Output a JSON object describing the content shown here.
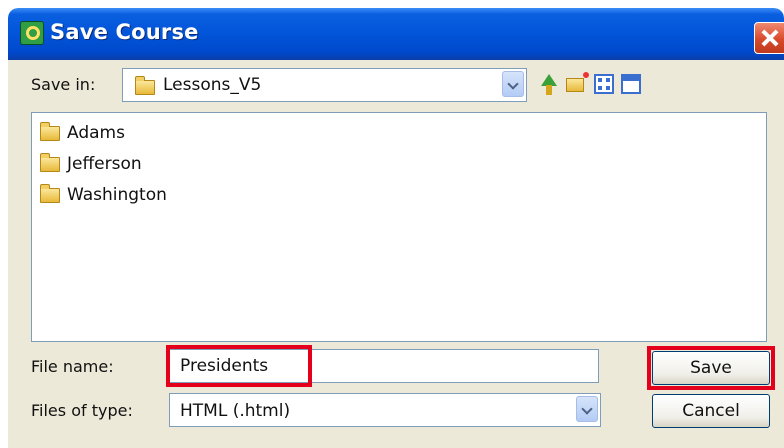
{
  "dialog": {
    "title": "Save Course"
  },
  "save_in": {
    "label": "Save in:",
    "value": "Lessons_V5"
  },
  "file_list": {
    "items": [
      {
        "name": "Adams",
        "icon": "folder-icon"
      },
      {
        "name": "Jefferson",
        "icon": "folder-icon"
      },
      {
        "name": "Washington",
        "icon": "folder-icon"
      }
    ]
  },
  "file_name": {
    "label": "File name:",
    "value": "Presidents"
  },
  "file_type": {
    "label": "Files of type:",
    "value": "HTML (.html)"
  },
  "buttons": {
    "save": "Save",
    "cancel": "Cancel"
  },
  "colors": {
    "titlebar": "#0254d8",
    "dialog_bg": "#ece9d8",
    "highlight": "#e4001b"
  }
}
